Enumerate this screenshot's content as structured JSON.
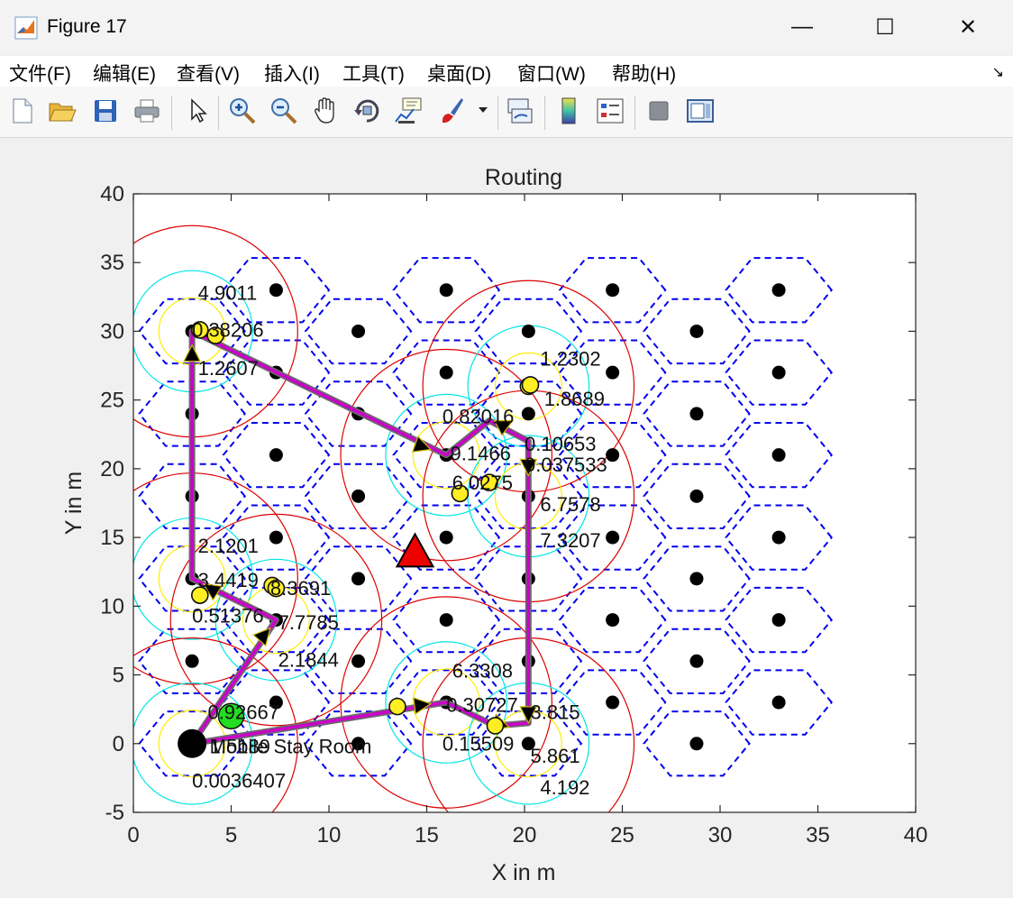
{
  "window": {
    "title": "Figure 17",
    "minimize_glyph": "—",
    "maximize_glyph": "☐",
    "close_glyph": "✕"
  },
  "menu": {
    "items": [
      "文件(F)",
      "编辑(E)",
      "查看(V)",
      "插入(I)",
      "工具(T)",
      "桌面(D)",
      "窗口(W)",
      "帮助(H)"
    ],
    "overflow_glyph": "↘"
  },
  "toolbar": {
    "buttons": [
      {
        "name": "new-figure-icon"
      },
      {
        "name": "open-file-icon"
      },
      {
        "name": "save-icon"
      },
      {
        "name": "print-icon"
      },
      {
        "name": "pointer-icon"
      },
      {
        "name": "zoom-in-icon"
      },
      {
        "name": "zoom-out-icon"
      },
      {
        "name": "pan-hand-icon"
      },
      {
        "name": "rotate-3d-icon"
      },
      {
        "name": "data-cursor-icon"
      },
      {
        "name": "brush-icon"
      },
      {
        "name": "brush-dropdown-icon"
      },
      {
        "name": "link-plot-icon"
      },
      {
        "name": "colorbar-icon"
      },
      {
        "name": "legend-icon"
      },
      {
        "name": "hide-plot-tools-icon"
      },
      {
        "name": "show-plot-tools-icon"
      }
    ]
  },
  "chart_data": {
    "type": "scatter",
    "title": "Routing",
    "xlabel": "X in m",
    "ylabel": "Y in m",
    "xlim": [
      0,
      40
    ],
    "ylim": [
      -5,
      40
    ],
    "xticks": [
      "0",
      "5",
      "10",
      "15",
      "20",
      "25",
      "30",
      "35",
      "40"
    ],
    "yticks": [
      "-5",
      "0",
      "5",
      "10",
      "15",
      "20",
      "25",
      "30",
      "35",
      "40"
    ],
    "grid": false,
    "colors": {
      "hex": "#0000ee",
      "route": "#cc00cc",
      "node": "#000000",
      "sensor": "#ffee22",
      "near_ring": "#ffee00",
      "mid_ring": "#00e5e5",
      "far_ring": "#dd0000",
      "sink": "#ee0000",
      "start": "#22dd22"
    },
    "cell_centers": [
      [
        3,
        0
      ],
      [
        7.3,
        3
      ],
      [
        11.5,
        0
      ],
      [
        16,
        3
      ],
      [
        20.2,
        0
      ],
      [
        24.5,
        3
      ],
      [
        28.8,
        0
      ],
      [
        33,
        3
      ],
      [
        3,
        6
      ],
      [
        7.3,
        9
      ],
      [
        11.5,
        6
      ],
      [
        16,
        9
      ],
      [
        20.2,
        6
      ],
      [
        24.5,
        9
      ],
      [
        28.8,
        6
      ],
      [
        33,
        9
      ],
      [
        3,
        12
      ],
      [
        7.3,
        15
      ],
      [
        11.5,
        12
      ],
      [
        16,
        15
      ],
      [
        20.2,
        12
      ],
      [
        24.5,
        15
      ],
      [
        28.8,
        12
      ],
      [
        33,
        15
      ],
      [
        3,
        18
      ],
      [
        7.3,
        21
      ],
      [
        11.5,
        18
      ],
      [
        16,
        21
      ],
      [
        20.2,
        18
      ],
      [
        24.5,
        21
      ],
      [
        28.8,
        18
      ],
      [
        33,
        21
      ],
      [
        3,
        24
      ],
      [
        7.3,
        27
      ],
      [
        11.5,
        24
      ],
      [
        16,
        27
      ],
      [
        20.2,
        24
      ],
      [
        24.5,
        27
      ],
      [
        28.8,
        24
      ],
      [
        33,
        27
      ],
      [
        3,
        30
      ],
      [
        7.3,
        33
      ],
      [
        11.5,
        30
      ],
      [
        16,
        33
      ],
      [
        20.2,
        30
      ],
      [
        24.5,
        33
      ],
      [
        28.8,
        30
      ],
      [
        33,
        33
      ]
    ],
    "route_nodes": [
      {
        "x": 3,
        "y": 0
      },
      {
        "x": 3,
        "y": 30
      },
      {
        "x": 16,
        "y": 21
      },
      {
        "x": 20.2,
        "y": 18
      },
      {
        "x": 3,
        "y": 12
      },
      {
        "x": 7.3,
        "y": 9
      },
      {
        "x": 16,
        "y": 3
      },
      {
        "x": 20.2,
        "y": 0
      }
    ],
    "route_path": [
      [
        3,
        0
      ],
      [
        16,
        3
      ],
      [
        18.5,
        1.3
      ],
      [
        20.2,
        1.5
      ],
      [
        20.2,
        18
      ],
      [
        20.2,
        22
      ],
      [
        18.2,
        23.5
      ],
      [
        16,
        21
      ],
      [
        3,
        30
      ],
      [
        3,
        12
      ],
      [
        7.3,
        9
      ],
      [
        3,
        0
      ]
    ],
    "arrows": [
      {
        "from": [
          3,
          25
        ],
        "to": [
          3,
          29
        ]
      },
      {
        "from": [
          11,
          23.5
        ],
        "to": [
          15.2,
          21.4
        ]
      },
      {
        "from": [
          18,
          22.5
        ],
        "to": [
          19.4,
          23.5
        ]
      },
      {
        "from": [
          20.2,
          22
        ],
        "to": [
          20.2,
          19.5
        ]
      },
      {
        "from": [
          5,
          10.3
        ],
        "to": [
          3.6,
          11.6
        ]
      },
      {
        "from": [
          5.5,
          6
        ],
        "to": [
          7,
          8.4
        ]
      },
      {
        "from": [
          13,
          2.5
        ],
        "to": [
          15.2,
          2.9
        ]
      },
      {
        "from": [
          17.5,
          2
        ],
        "to": [
          19.2,
          1.2
        ]
      },
      {
        "from": [
          20.2,
          4
        ],
        "to": [
          20.2,
          1.5
        ]
      }
    ],
    "range_circles": [
      {
        "x": 3,
        "y": 30,
        "rings": [
          1.7,
          3.1,
          5.4
        ]
      },
      {
        "x": 3,
        "y": 12,
        "rings": [
          1.7,
          3.1,
          5.4
        ]
      },
      {
        "x": 7.3,
        "y": 9,
        "rings": [
          1.7,
          3.1,
          5.4
        ]
      },
      {
        "x": 3,
        "y": 0,
        "rings": [
          1.7,
          3.1,
          5.4
        ]
      },
      {
        "x": 16,
        "y": 21,
        "rings": [
          1.7,
          3.1,
          5.4
        ]
      },
      {
        "x": 20.2,
        "y": 26,
        "rings": [
          1.7,
          3.1,
          5.4
        ]
      },
      {
        "x": 20.2,
        "y": 18,
        "rings": [
          1.7,
          3.1,
          5.4
        ]
      },
      {
        "x": 16,
        "y": 3,
        "rings": [
          1.7,
          3.1,
          5.4
        ]
      },
      {
        "x": 20.2,
        "y": 0,
        "rings": [
          1.7,
          3.1,
          5.4
        ]
      }
    ],
    "sensors": [
      [
        3.4,
        30.1
      ],
      [
        4.2,
        29.7
      ],
      [
        3.4,
        10.8
      ],
      [
        7.1,
        11.5
      ],
      [
        7.3,
        11.3
      ],
      [
        20.2,
        26
      ],
      [
        20.3,
        26.1
      ],
      [
        16.7,
        18.2
      ],
      [
        18.2,
        19
      ],
      [
        13.5,
        2.7
      ],
      [
        18.5,
        1.3
      ]
    ],
    "sink": {
      "x": 14.4,
      "y": 13.8
    },
    "start_node": {
      "x": 5,
      "y": 2
    },
    "mobile_node": {
      "x": 3,
      "y": 0
    },
    "annotations": [
      {
        "text": "4.9011",
        "x": 3.3,
        "y": 32.3
      },
      {
        "text": "0.38206",
        "x": 3.0,
        "y": 29.6
      },
      {
        "text": "1.2607",
        "x": 3.3,
        "y": 26.8
      },
      {
        "text": "1.2302",
        "x": 20.8,
        "y": 27.5
      },
      {
        "text": "1.8689",
        "x": 21.0,
        "y": 24.6
      },
      {
        "text": "0.82016",
        "x": 15.8,
        "y": 23.3
      },
      {
        "text": "9.1466",
        "x": 16.2,
        "y": 20.6
      },
      {
        "text": "0.10653",
        "x": 20.0,
        "y": 21.3
      },
      {
        "text": "0.037533",
        "x": 20.0,
        "y": 19.8
      },
      {
        "text": "6.0275",
        "x": 16.3,
        "y": 18.5
      },
      {
        "text": "6.7578",
        "x": 20.8,
        "y": 16.9
      },
      {
        "text": "7.3207",
        "x": 20.8,
        "y": 14.3
      },
      {
        "text": "2.1201",
        "x": 3.3,
        "y": 13.9
      },
      {
        "text": "3.4419",
        "x": 3.3,
        "y": 11.4
      },
      {
        "text": "8.3691",
        "x": 7.0,
        "y": 10.8
      },
      {
        "text": "0.51376",
        "x": 3.0,
        "y": 8.8
      },
      {
        "text": "7.7785",
        "x": 7.4,
        "y": 8.3
      },
      {
        "text": "2.1844",
        "x": 7.4,
        "y": 5.6
      },
      {
        "text": "6.3308",
        "x": 16.3,
        "y": 4.8
      },
      {
        "text": "0.30727",
        "x": 16.0,
        "y": 2.3
      },
      {
        "text": "3.815",
        "x": 20.3,
        "y": 1.8
      },
      {
        "text": "0.15509",
        "x": 15.8,
        "y": -0.5
      },
      {
        "text": "5.861",
        "x": 20.3,
        "y": -1.4
      },
      {
        "text": "4.192",
        "x": 20.8,
        "y": -3.7
      },
      {
        "text": "0.92667",
        "x": 3.8,
        "y": 1.8
      },
      {
        "text": "Mobile Stay Room",
        "x": 3.9,
        "y": -0.7
      },
      {
        "text": "1.5189",
        "x": 3.9,
        "y": -0.7
      },
      {
        "text": "0.0036407",
        "x": 3.0,
        "y": -3.2
      }
    ]
  }
}
